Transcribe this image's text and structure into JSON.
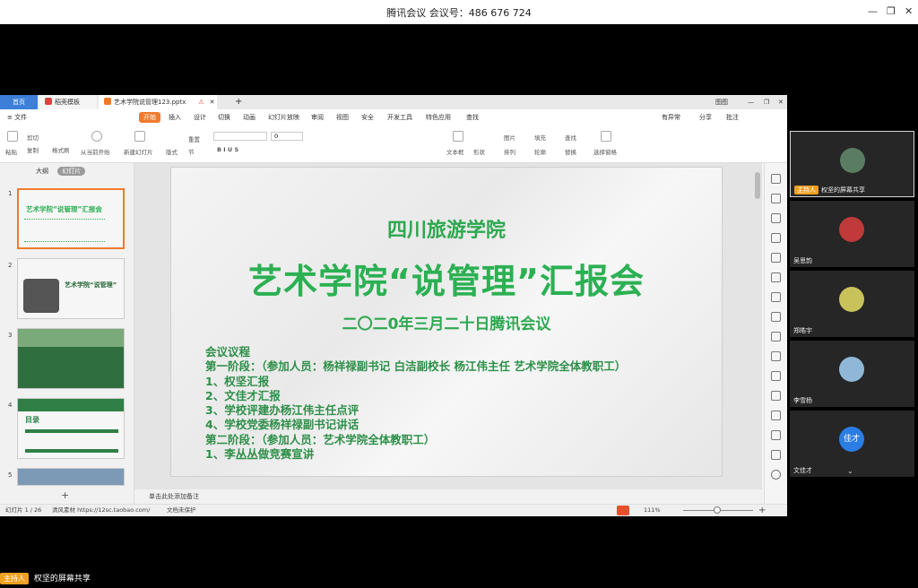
{
  "window": {
    "title": "腾讯会议 会议号：486 676 724"
  },
  "wps": {
    "tabs": {
      "home": "首页",
      "template": "稻壳模板",
      "file": "艺术学院说管理123.pptx",
      "user": "图图"
    },
    "menu": {
      "file": "≡ 文件",
      "start": "开始",
      "insert": "插入",
      "design": "设计",
      "switch": "切换",
      "animation": "动画",
      "show": "幻灯片放映",
      "review": "审阅",
      "view": "视图",
      "security": "安全",
      "dev": "开发工具",
      "special": "特色应用",
      "search": "查找",
      "changes": "有异常",
      "share": "分享",
      "annotate": "批注"
    },
    "ribbon": {
      "paste": "粘贴",
      "cut": "剪切",
      "copy": "复制",
      "format": "格式刷",
      "play": "从当前开始",
      "new_slide": "新建幻灯片",
      "layout": "版式",
      "section": "节",
      "reset": "重置",
      "font_size": "0",
      "textbox": "文本框",
      "shape": "形状",
      "arrange": "排列",
      "picture": "图片",
      "fill": "填充",
      "find": "查找",
      "replace": "替换",
      "select": "选择窗格",
      "outline_label": "轮廓"
    },
    "thumbs": {
      "outline": "大纲",
      "slides": "幻灯片",
      "nums": [
        "1",
        "2",
        "3",
        "4",
        "5"
      ],
      "t1_title": "艺术学院“说管理”汇报会",
      "t2_title": "艺术学院“说管理”",
      "t4_title": "目录"
    },
    "slide": {
      "school": "四川旅游学院",
      "title": "艺术学院“说管理”汇报会",
      "date": "二〇二0年三月二十日腾讯会议",
      "agenda": [
        "会议议程",
        "第一阶段：（参加人员：杨祥禄副书记  白洁副校长  杨江伟主任  艺术学院全体教职工）",
        "1、权坚汇报",
        "2、文佳才汇报",
        "3、学校评建办杨江伟主任点评",
        "4、学校党委杨祥禄副书记讲话",
        "第二阶段：（参加人员：艺术学院全体教职工）",
        "1、李丛丛做竞赛宣讲"
      ]
    },
    "notes": "单击此处添加备注",
    "status": {
      "page": "幻灯片 1 / 26",
      "theme": "清风素材 https://12sc.taobao.com/",
      "protect": "文档未保护",
      "zoom": "111%"
    }
  },
  "meeting": {
    "speaker_label": "权坚的屏幕共享",
    "host_badge": "主持人",
    "participants": [
      "吴思韵",
      "郑皓宇",
      "李雪杨",
      "文佳才"
    ],
    "avatar_text": "佳才",
    "bottom_share": "权坚的屏幕共享"
  },
  "colors": {
    "accent": "#2bb052",
    "orange": "#f07a2a",
    "blue": "#3b7fd9"
  }
}
